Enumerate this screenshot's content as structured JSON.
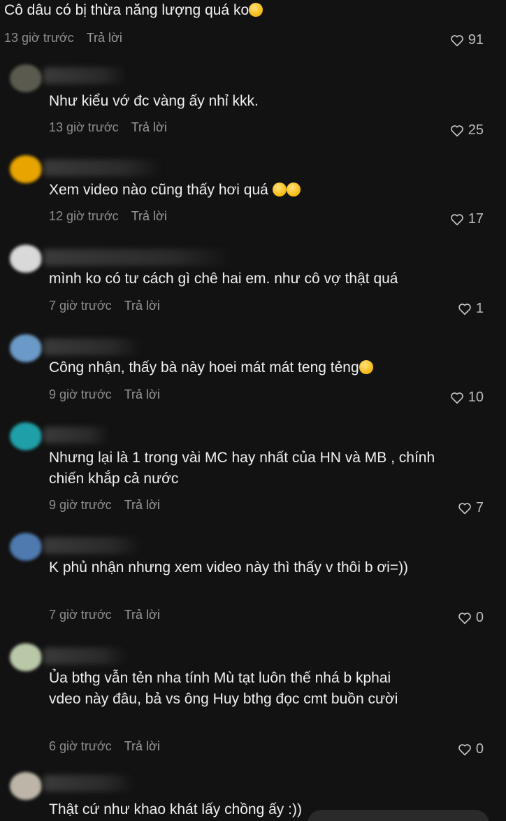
{
  "top_comment": {
    "text": "Cô dâu có bị thừa năng lượng quá ko",
    "time": "13 giờ trước",
    "reply": "Trả lời",
    "likes": "91"
  },
  "replies": [
    {
      "text": "Như kiểu vớ đc vàng ấy nhỉ kkk.",
      "time": "13 giờ trước",
      "reply": "Trả lời",
      "likes": "25",
      "avatar_color": "#5a5a4e"
    },
    {
      "text": "Xem video nào cũng thấy hơi quá",
      "time": "12 giờ trước",
      "reply": "Trả lời",
      "likes": "17",
      "avatar_color": "#e8a400"
    },
    {
      "text": "mình ko có tư cách gì chê hai em. như cô vợ thật quá",
      "time": "7 giờ trước",
      "reply": "Trả lời",
      "likes": "1",
      "avatar_color": "#d9d9d9"
    },
    {
      "text": "Công nhận, thấy bà này hoei mát mát teng tẻng",
      "time": "9 giờ trước",
      "reply": "Trả lời",
      "likes": "10",
      "avatar_color": "#6b9ac8"
    },
    {
      "text": "Nhưng lại là 1 trong vài MC hay nhất của HN và MB , chính chiến khắp cả nước",
      "time": "9 giờ trước",
      "reply": "Trả lời",
      "likes": "7",
      "avatar_color": "#1fa0a8"
    },
    {
      "text": "K phủ nhận nhưng xem video này thì thấy v thôi b ơi=))",
      "time": "7 giờ trước",
      "reply": "Trả lời",
      "likes": "0",
      "avatar_color": "#4f7ab0"
    },
    {
      "text": "Ủa bthg vẫn tẻn nha tính Mù tạt luôn thế nhá b kphai vdeo này đâu, bả vs ông Huy bthg đọc cmt buồn cười",
      "time": "6 giờ trước",
      "reply": "Trả lời",
      "likes": "0",
      "avatar_color": "#b9c9a8"
    },
    {
      "text": "Thật cứ như khao khát lấy chồng ấy :))",
      "time": "",
      "reply": "",
      "likes": "",
      "avatar_color": "#bdb6a8"
    }
  ]
}
